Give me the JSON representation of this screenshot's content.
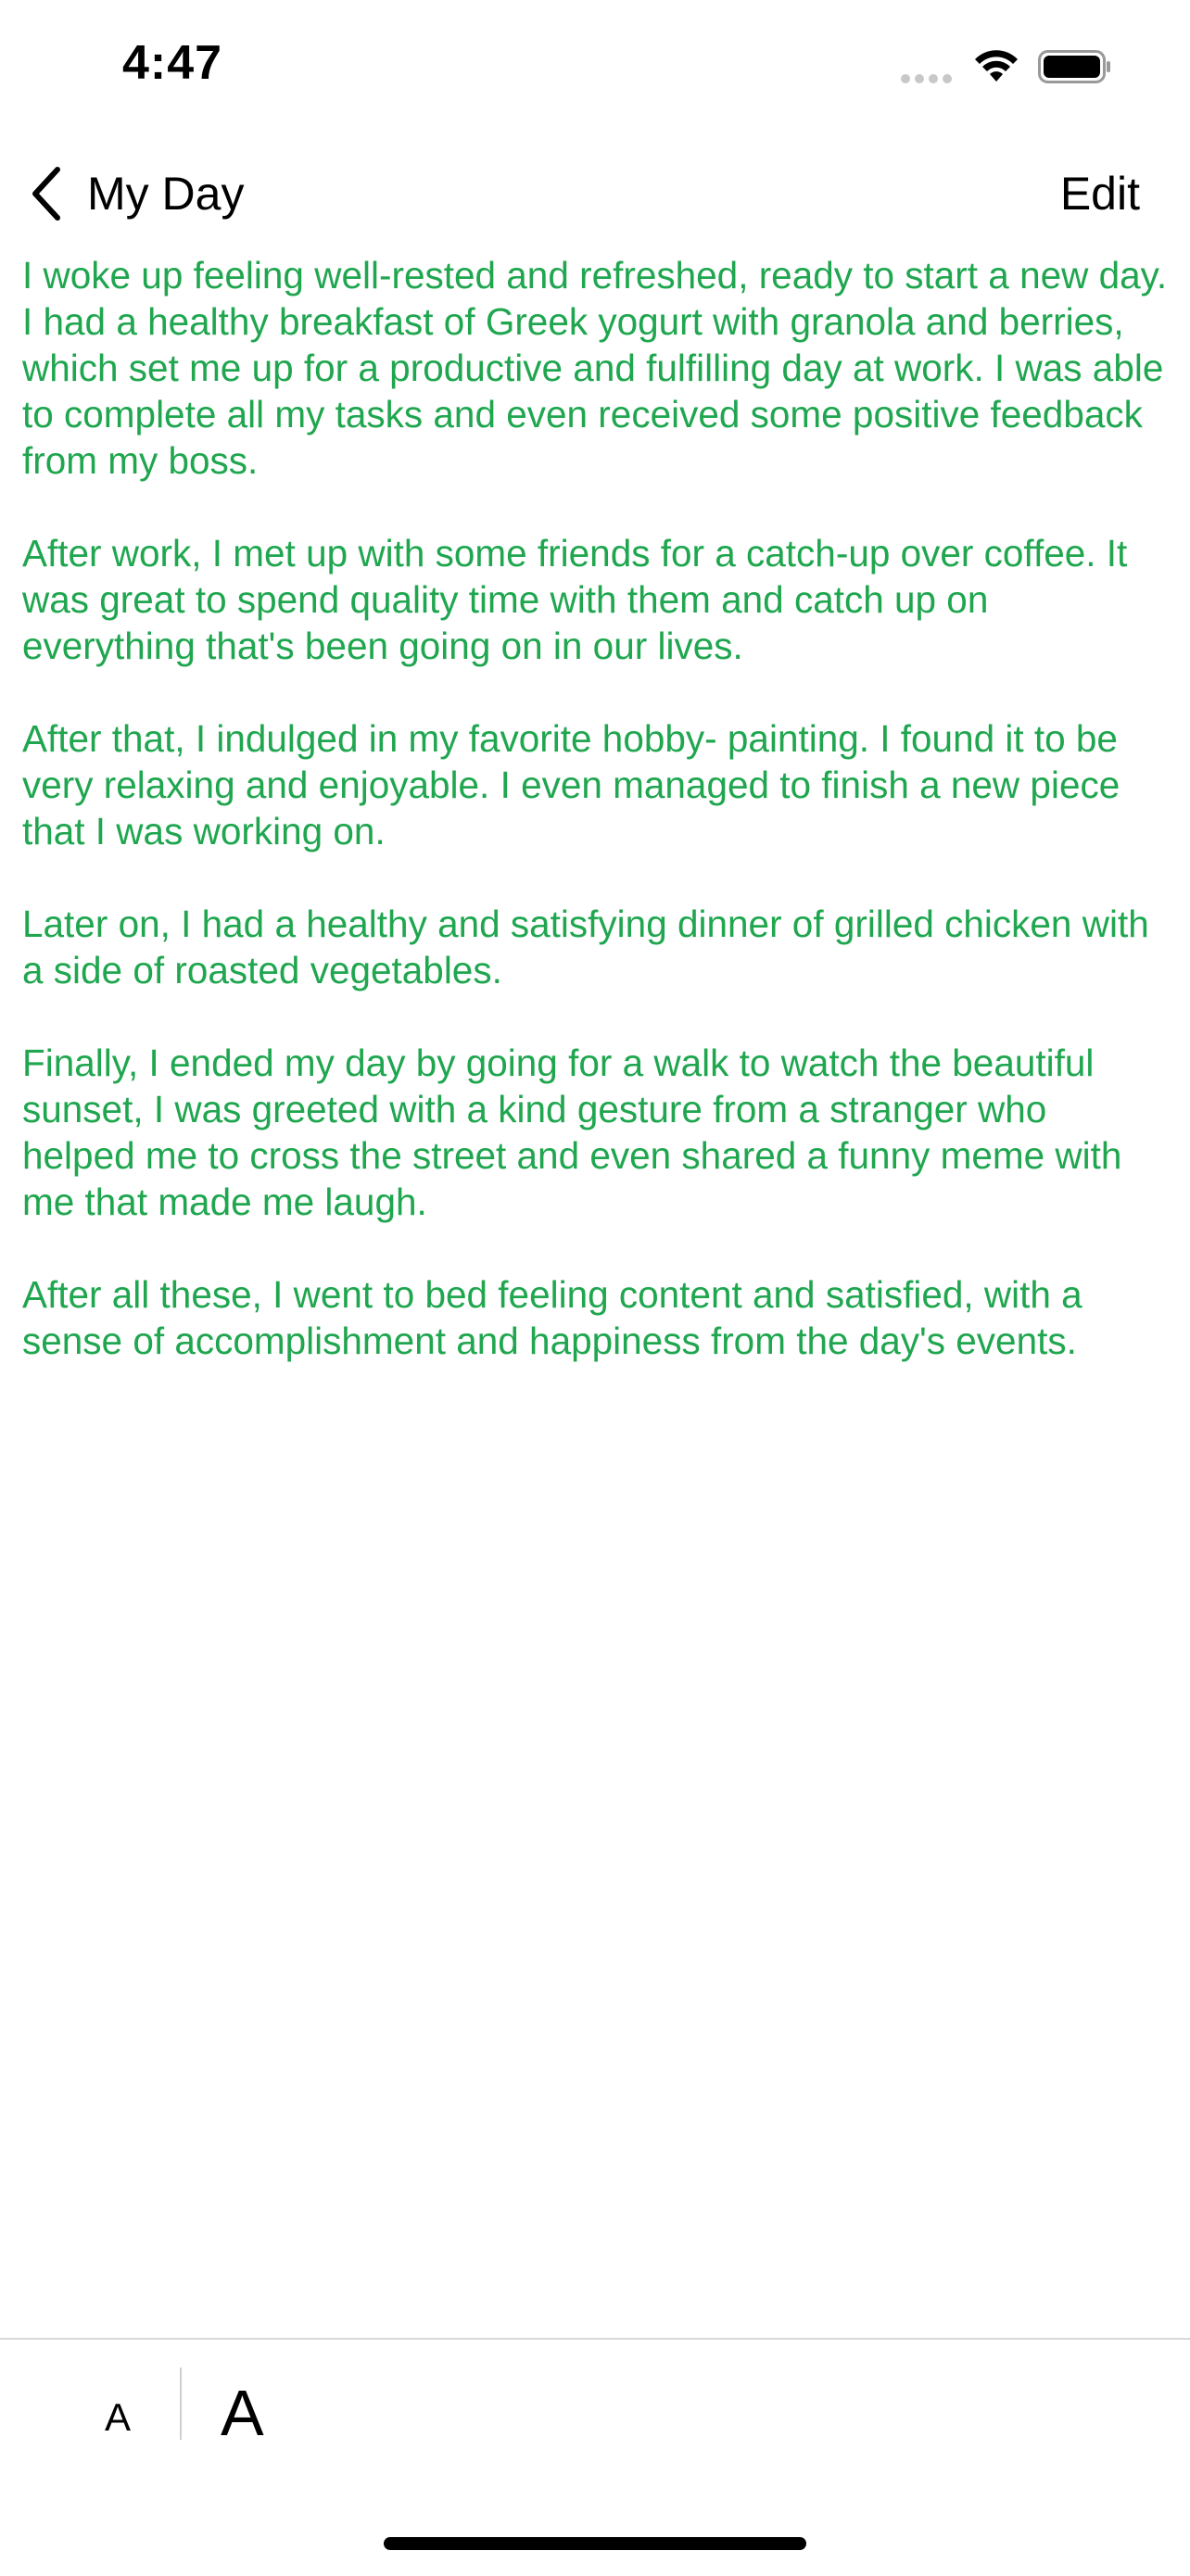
{
  "status_bar": {
    "time": "4:47"
  },
  "nav": {
    "back_label": "My Day",
    "edit_label": "Edit"
  },
  "content": {
    "color": "#1fa64f",
    "paragraphs": [
      "I woke up feeling well-rested and refreshed, ready to start a new day. I had a healthy breakfast of Greek yogurt with granola and berries, which set me up for a productive and fulfilling day at work. I was able to complete all my tasks and even received some positive feedback from my boss.",
      "After work, I met up with some friends for a catch-up over coffee. It was great to spend quality time with them and catch up on everything that's been going on in our lives.",
      "After that, I indulged in my favorite hobby- painting. I found it to be very relaxing and enjoyable. I even managed to finish a new piece that I was working on.",
      "Later on, I had a healthy and satisfying dinner of grilled chicken with a side of roasted vegetables.",
      "Finally, I ended my day by going for a walk to watch the beautiful sunset, I was greeted with a kind gesture from a stranger who helped me to cross the street and even shared a funny meme with me that made me laugh.",
      "After all these, I went to bed feeling content and satisfied, with a sense of accomplishment and happiness from the day's events."
    ]
  },
  "toolbar": {
    "font_small_label": "A",
    "font_large_label": "A"
  },
  "icons": {
    "back": "chevron-left-icon",
    "wifi": "wifi-icon",
    "battery": "battery-icon",
    "signal": "signal-dots-icon"
  }
}
